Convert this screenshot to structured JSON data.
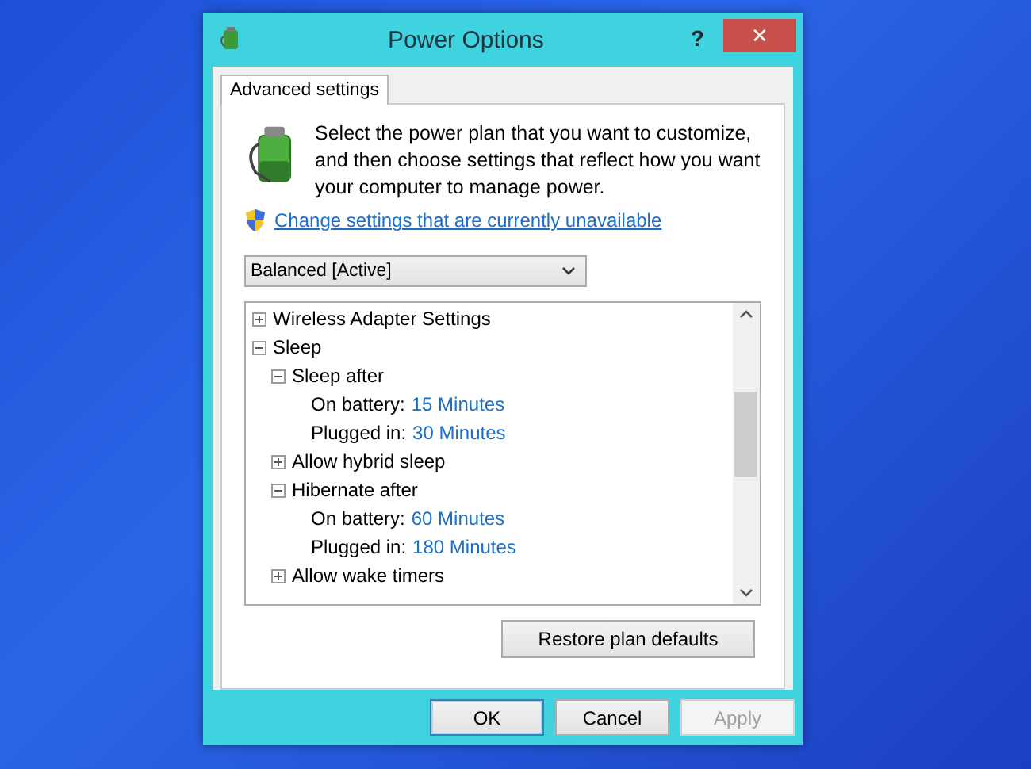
{
  "window": {
    "title": "Power Options",
    "help": "?",
    "close": "✕"
  },
  "tabs": [
    {
      "label": "Advanced settings",
      "selected": true
    }
  ],
  "intro": "Select the power plan that you want to customize, and then choose settings that reflect how you want your computer to manage power.",
  "admin_link": "Change settings that are currently unavailable",
  "plan_dropdown": {
    "value": "Balanced [Active]"
  },
  "tree": [
    {
      "label": "Wireless Adapter Settings",
      "expanded": false
    },
    {
      "label": "Sleep",
      "expanded": true,
      "children": [
        {
          "label": "Sleep after",
          "expanded": true,
          "children": [
            {
              "kind": "setting",
              "label": "On battery:",
              "value": "15 Minutes"
            },
            {
              "kind": "setting",
              "label": "Plugged in:",
              "value": "30 Minutes"
            }
          ]
        },
        {
          "label": "Allow hybrid sleep",
          "expanded": false
        },
        {
          "label": "Hibernate after",
          "expanded": true,
          "children": [
            {
              "kind": "setting",
              "label": "On battery:",
              "value": "60 Minutes"
            },
            {
              "kind": "setting",
              "label": "Plugged in:",
              "value": "180 Minutes"
            }
          ]
        },
        {
          "label": "Allow wake timers",
          "expanded": false
        }
      ]
    }
  ],
  "restore_button": "Restore plan defaults",
  "buttons": [
    {
      "label": "OK",
      "default": true,
      "disabled": false
    },
    {
      "label": "Cancel",
      "default": false,
      "disabled": false
    },
    {
      "label": "Apply",
      "default": false,
      "disabled": true
    }
  ]
}
